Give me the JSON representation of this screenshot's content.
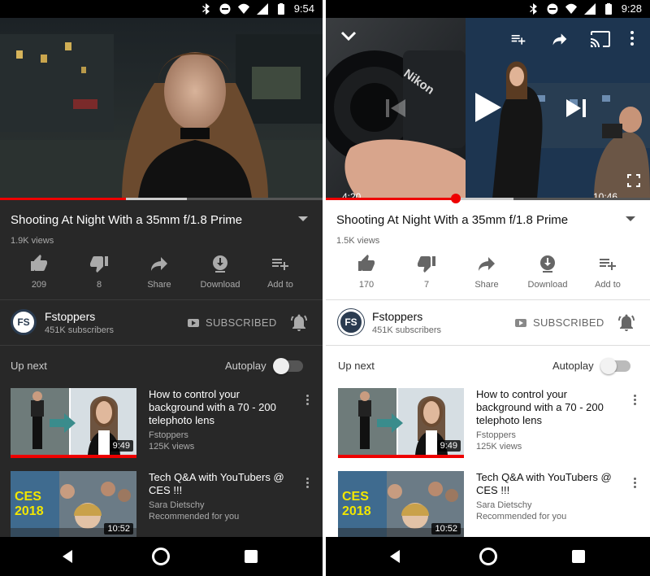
{
  "dark_screen": {
    "status_time": "9:54",
    "video_title": "Shooting At Night With a 35mm f/1.8 Prime",
    "views": "1.9K views",
    "progress_played": 0.39,
    "progress_buffered": 0.58,
    "actions": [
      {
        "label": "209",
        "icon": "thumbs-up-icon"
      },
      {
        "label": "8",
        "icon": "thumbs-down-icon"
      },
      {
        "label": "Share",
        "icon": "share-icon"
      },
      {
        "label": "Download",
        "icon": "download-icon"
      },
      {
        "label": "Add to",
        "icon": "playlist-add-icon"
      }
    ],
    "channel": {
      "avatar_text": "FS",
      "name": "Fstoppers",
      "subscribers": "451K subscribers",
      "subscribed_label": "SUBSCRIBED"
    },
    "upnext_label": "Up next",
    "autoplay_label": "Autoplay",
    "recommendations": [
      {
        "title": "How to control your background with a 70 - 200 telephoto lens",
        "channel": "Fstoppers",
        "views": "125K views",
        "duration": "9:49"
      },
      {
        "title": "Tech Q&A with YouTubers @ CES !!!",
        "channel": "Sara Dietschy",
        "views": "Recommended for you",
        "duration": "10:52",
        "thumb_text_1": "CES",
        "thumb_text_2": "2018"
      }
    ]
  },
  "light_screen": {
    "status_time": "9:28",
    "video_title": "Shooting At Night With a 35mm f/1.8 Prime",
    "views": "1.5K views",
    "time_current": "4:20",
    "time_total": "10:46",
    "progress_played": 0.4,
    "progress_buffered": 0.58,
    "camera_brand": "Nikon",
    "actions": [
      {
        "label": "170",
        "icon": "thumbs-up-icon"
      },
      {
        "label": "7",
        "icon": "thumbs-down-icon"
      },
      {
        "label": "Share",
        "icon": "share-icon"
      },
      {
        "label": "Download",
        "icon": "download-icon"
      },
      {
        "label": "Add to",
        "icon": "playlist-add-icon"
      }
    ],
    "channel": {
      "avatar_text": "FS",
      "name": "Fstoppers",
      "subscribers": "451K subscribers",
      "subscribed_label": "SUBSCRIBED"
    },
    "upnext_label": "Up next",
    "autoplay_label": "Autoplay",
    "recommendations": [
      {
        "title": "How to control your background with a 70 - 200 telephoto lens",
        "channel": "Fstoppers",
        "views": "125K views",
        "duration": "9:49"
      },
      {
        "title": "Tech Q&A with YouTubers @ CES !!!",
        "channel": "Sara Dietschy",
        "views": "Recommended for you",
        "duration": "10:52",
        "thumb_text_1": "CES",
        "thumb_text_2": "2018"
      }
    ]
  },
  "colors": {
    "accent_red": "#e00000",
    "dark_bg": "#282828",
    "light_bg": "#ffffff"
  }
}
